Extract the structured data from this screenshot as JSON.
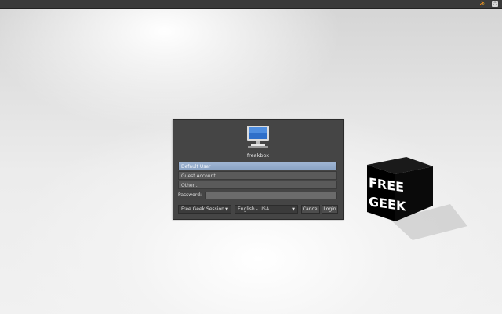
{
  "topbar": {
    "accessibility_icon": "accessibility-icon",
    "power_icon": "power-icon"
  },
  "dialog": {
    "hostname": "freakbox",
    "users": [
      {
        "label": "Default User",
        "selected": true
      },
      {
        "label": "Guest Account",
        "selected": false
      },
      {
        "label": "Other...",
        "selected": false
      }
    ],
    "password_label": "Password:",
    "password_value": "",
    "session_selected": "Free Geek Session",
    "language_selected": "English - USA",
    "cancel_label": "Cancel",
    "login_label": "Login"
  },
  "cube": {
    "line1": "FREE",
    "line2": "GEEK"
  },
  "colors": {
    "dialog_bg": "#454545",
    "selected_row": "#9fb5d3",
    "cube": "#000000"
  }
}
